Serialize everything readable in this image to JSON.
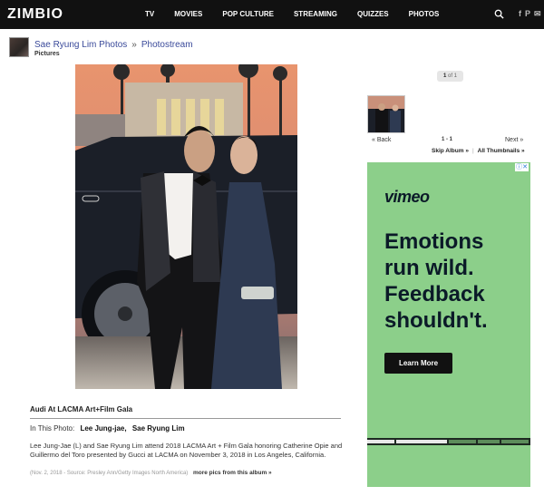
{
  "header": {
    "logo": "ZIMBIO",
    "nav": [
      "TV",
      "MOVIES",
      "POP CULTURE",
      "STREAMING",
      "QUIZZES",
      "PHOTOS"
    ],
    "social": [
      "f",
      "P",
      "✉"
    ]
  },
  "breadcrumb": {
    "root": "Sae Ryung Lim Photos",
    "separator": "»",
    "current": "Photostream",
    "sub": "Pictures"
  },
  "photo": {
    "title": "Audi At LACMA Art+Film Gala",
    "in_photo_label": "In This Photo:",
    "people": [
      "Lee Jung-jae,",
      "Sae Ryung Lim"
    ],
    "description": "Lee Jung-Jae (L) and Sae Ryung Lim attend 2018 LACMA Art + Film Gala honoring Catherine Opie and Guillermo del Toro presented by Gucci at LACMA on November 3, 2018 in Los Angeles, California.",
    "meta": "(Nov. 2, 2018 - Source: Presley Ann/Getty Images North America)",
    "more_link": "more pics from this album »"
  },
  "sidebar": {
    "badge_current": "1",
    "badge_of": "of 1",
    "back": "« Back",
    "count": "1 - 1",
    "next": "Next »",
    "skip_album": "Skip Album »",
    "divider": "|",
    "all_thumbnails": "All Thumbnails »"
  },
  "ad": {
    "brand": "vimeo",
    "headline_lines": [
      "Emotions",
      "run wild.",
      "Feedback",
      "shouldn't."
    ],
    "cta": "Learn More",
    "choice_icon": "ⓘ✕",
    "colors": {
      "background": "#8ccf8a",
      "text": "#0b1a28",
      "cta": "#111111"
    }
  }
}
